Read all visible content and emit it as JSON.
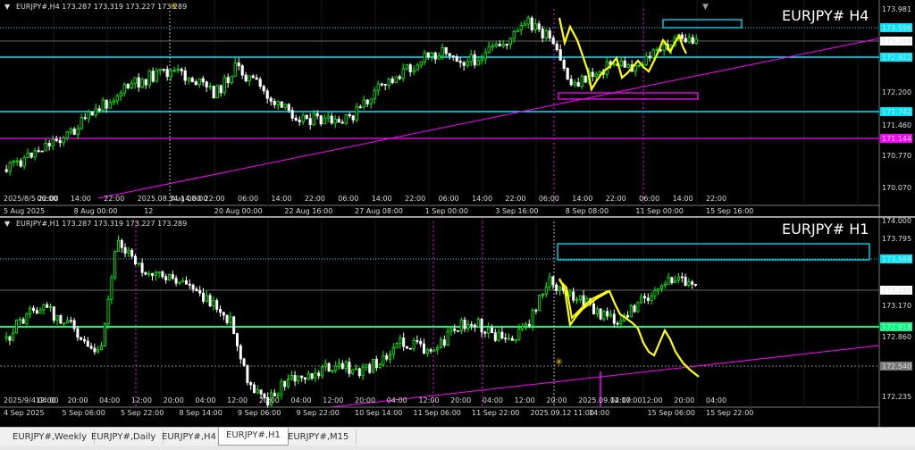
{
  "h4": {
    "header": "EURJPY#,H4  173.287 173.319 173.227 173.289",
    "symbol_label": "EURJPY# H4",
    "price_labels": [
      {
        "text": "173.981",
        "kind": "axis"
      },
      {
        "text": "173.596",
        "kind": "cyan"
      },
      {
        "text": "173.289",
        "kind": "current"
      },
      {
        "text": "172.922",
        "kind": "cyan"
      },
      {
        "text": "172.200",
        "kind": "axis"
      },
      {
        "text": "171.742",
        "kind": "cyan"
      },
      {
        "text": "171.460",
        "kind": "axis"
      },
      {
        "text": "171.144",
        "kind": "magenta"
      },
      {
        "text": "170.770",
        "kind": "axis"
      },
      {
        "text": "170.070",
        "kind": "axis"
      }
    ],
    "time_labels": [
      "2025/8/5 22:00",
      "06:00",
      "14:00",
      "22:00",
      "2025.08.14 14:00",
      "Aug 08:00",
      "22:00",
      "06:00",
      "14:00",
      "22:00",
      "06:00",
      "14:00",
      "22:00",
      "06:00",
      "14:00",
      "22:00",
      "06:00",
      "14:00",
      "22:00",
      "06:00",
      "14:00",
      "22:00"
    ],
    "date_labels": [
      "5 Aug 2025",
      "8 Aug 00:00",
      "12",
      "20 Aug 00:00",
      "22 Aug 16:00",
      "27 Aug 08:00",
      "1 Sep 00:00",
      "3 Sep 16:00",
      "8 Sep 08:00",
      "11 Sep 00:00",
      "15 Sep 16:00"
    ]
  },
  "h1": {
    "header": "EURJPY#,H1  173.287 173.319 173.227 173.289",
    "symbol_label": "EURJPY# H1",
    "price_labels": [
      {
        "text": "174.000",
        "kind": "axis"
      },
      {
        "text": "173.795",
        "kind": "axis"
      },
      {
        "text": "173.588",
        "kind": "cyan"
      },
      {
        "text": "173.289",
        "kind": "current"
      },
      {
        "text": "173.170",
        "kind": "axis"
      },
      {
        "text": "172.918",
        "kind": "green"
      },
      {
        "text": "172.860",
        "kind": "axis"
      },
      {
        "text": "172.540",
        "kind": "gray"
      },
      {
        "text": "172.235",
        "kind": "axis"
      }
    ],
    "time_labels": [
      "2025/9/4 04:00",
      "12:00",
      "20:00",
      "04:00",
      "12:00",
      "20:00",
      "04:00",
      "12:00",
      "20:00",
      "04:00",
      "12:00",
      "20:00",
      "04:00",
      "12:00",
      "20:00",
      "04:00",
      "12:00",
      "20:00",
      "2025.09.12 17:00",
      "04:00",
      "12:00",
      "20:00",
      "04:00"
    ],
    "date_labels": [
      "4 Sep 2025",
      "5 Sep 06:00",
      "5 Sep 22:00",
      "8 Sep 14:00",
      "9 Sep 06:00",
      "9 Sep 22:00",
      "10 Sep 14:00",
      "11 Sep 06:00",
      "11 Sep 22:00",
      "2025.09.12 11:00",
      "14:00",
      "15 Sep 06:00",
      "15 Sep 22:00"
    ]
  },
  "tabs": [
    {
      "label": "EURJPY#,Weekly",
      "active": false
    },
    {
      "label": "EURJPY#,Daily",
      "active": false
    },
    {
      "label": "EURJPY#,H4",
      "active": false
    },
    {
      "label": "EURJPY#,H1",
      "active": true
    },
    {
      "label": "EURJPY#,M15",
      "active": false
    }
  ],
  "colors": {
    "bull": "#00ff00",
    "bear": "#ffffff",
    "cyan": "#00e5ff",
    "magenta": "#ff00ff",
    "yellow": "#ffff00",
    "green_line": "#00ff7f",
    "grid": "#2a2a2a",
    "axis_bg": "#000000"
  }
}
